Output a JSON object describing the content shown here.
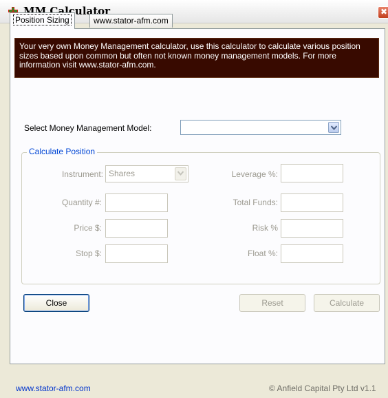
{
  "window": {
    "title": "MM Calculator",
    "close_glyph": "✖"
  },
  "tabs": [
    {
      "label": "Position Sizing",
      "active": true
    },
    {
      "label": "www.stator-afm.com",
      "active": false
    }
  ],
  "banner": {
    "text": "Your very own Money Management calculator, use this calculator to calculate various position sizes based upon common but often not known money management models. For more information visit www.stator-afm.com."
  },
  "model_select": {
    "label": "Select Money Management Model:",
    "value": ""
  },
  "calculate_position": {
    "legend": "Calculate Position",
    "instrument": {
      "label": "Instrument:",
      "value": "Shares"
    },
    "quantity": {
      "label": "Quantity #:",
      "value": ""
    },
    "price": {
      "label": "Price $:",
      "value": ""
    },
    "stop": {
      "label": "Stop $:",
      "value": ""
    },
    "leverage": {
      "label": "Leverage %:",
      "value": ""
    },
    "total_funds": {
      "label": "Total Funds:",
      "value": ""
    },
    "risk": {
      "label": "Risk %",
      "value": ""
    },
    "float": {
      "label": "Float %:",
      "value": ""
    }
  },
  "buttons": {
    "close": "Close",
    "reset": "Reset",
    "calculate": "Calculate"
  },
  "status": {
    "link": "www.stator-afm.com",
    "copyright": "© Anfield Capital Pty Ltd v1.1"
  },
  "colors": {
    "banner_bg": "#380a00",
    "legend_text": "#0046d5",
    "link": "#0033cc"
  }
}
